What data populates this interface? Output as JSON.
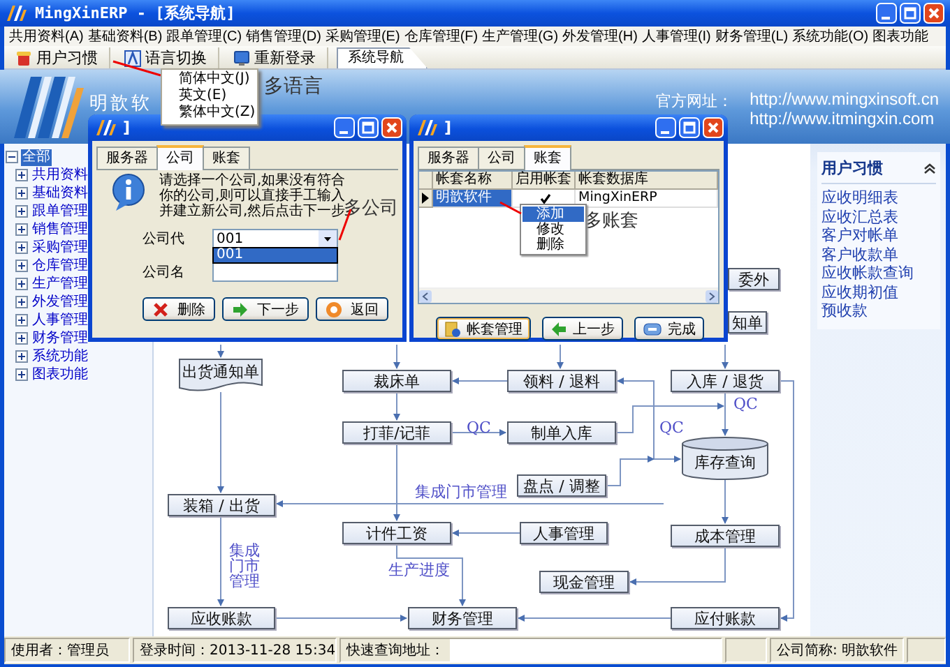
{
  "window": {
    "title": "MingXinERP - [系统导航]"
  },
  "menu_bar": [
    "共用资料(A)",
    "基础资料(B)",
    "跟单管理(C)",
    "销售管理(D)",
    "采购管理(E)",
    "仓库管理(F)",
    "生产管理(G)",
    "外发管理(H)",
    "人事管理(I)",
    "财务管理(L)",
    "系统功能(O)",
    "图表功能"
  ],
  "toolbar": [
    {
      "label": "用户习惯",
      "kind": "habits"
    },
    {
      "label": "语言切换",
      "kind": "language"
    },
    {
      "label": "重新登录",
      "kind": "relogin"
    }
  ],
  "document_tabs": [
    {
      "label": "系统导航",
      "selected": true
    }
  ],
  "language_menu": {
    "items": [
      "简体中文(J)",
      "英文(E)",
      "繁体中文(Z)"
    ],
    "annotation": "多语言"
  },
  "banner": {
    "brand": "明歆软",
    "site_label": "官方网址：",
    "urls": [
      "http://www.mingxinsoft.cn",
      "http://www.itmingxin.com"
    ]
  },
  "tree": [
    {
      "label": "全部",
      "selected": true,
      "expanded": true,
      "children": [
        {
          "label": "共用资料",
          "selected": false,
          "expanded": false
        },
        {
          "label": "基础资料",
          "selected": false,
          "expanded": false
        },
        {
          "label": "跟单管理",
          "selected": false,
          "expanded": false
        },
        {
          "label": "销售管理",
          "selected": false,
          "expanded": false
        },
        {
          "label": "采购管理",
          "selected": false,
          "expanded": false
        },
        {
          "label": "仓库管理",
          "selected": false,
          "expanded": false
        },
        {
          "label": "生产管理",
          "selected": false,
          "expanded": false
        },
        {
          "label": "外发管理",
          "selected": false,
          "expanded": false
        },
        {
          "label": "人事管理",
          "selected": false,
          "expanded": false
        },
        {
          "label": "财务管理",
          "selected": false,
          "expanded": false
        },
        {
          "label": "系统功能",
          "selected": false,
          "expanded": false
        },
        {
          "label": "图表功能",
          "selected": false,
          "expanded": false
        }
      ]
    }
  ],
  "flowchart": {
    "nodes": [
      {
        "kind": "box",
        "label": "委外"
      },
      {
        "kind": "box",
        "label": "知单"
      },
      {
        "kind": "document",
        "label": "出货通知单"
      },
      {
        "kind": "box",
        "label": "裁床单"
      },
      {
        "kind": "box",
        "label": "领料 / 退料"
      },
      {
        "kind": "box",
        "label": "入库 / 退货"
      },
      {
        "kind": "box",
        "label": "打菲/记菲"
      },
      {
        "kind": "box",
        "label": "制单入库"
      },
      {
        "kind": "cylinder",
        "label": "库存查询"
      },
      {
        "kind": "box",
        "label": "盘点 / 调整"
      },
      {
        "kind": "box",
        "label": "装箱 / 出货"
      },
      {
        "kind": "box",
        "label": "计件工资"
      },
      {
        "kind": "box",
        "label": "人事管理"
      },
      {
        "kind": "box",
        "label": "成本管理"
      },
      {
        "kind": "box",
        "label": "现金管理"
      },
      {
        "kind": "box",
        "label": "应收账款"
      },
      {
        "kind": "box",
        "label": "财务管理"
      },
      {
        "kind": "box",
        "label": "应付账款"
      }
    ],
    "labels": [
      {
        "kind": "horizontal",
        "text": "QC"
      },
      {
        "kind": "horizontal",
        "text": "QC"
      },
      {
        "kind": "horizontal",
        "text": "QC"
      },
      {
        "kind": "horizontal",
        "text": "集成门市管理"
      },
      {
        "kind": "vertical",
        "text": "集成门市管理"
      },
      {
        "kind": "horizontal",
        "text": "生产进度"
      }
    ]
  },
  "user_panel": {
    "title": "用户习惯",
    "links": [
      "应收明细表",
      "应收汇总表",
      "客户对帐单",
      "客户收款单",
      "应收帐款查询",
      "应收期初值",
      "预收款"
    ]
  },
  "company_dialog": {
    "title": "]",
    "tabs": [
      {
        "label": "服务器",
        "selected": false
      },
      {
        "label": "公司",
        "selected": true
      },
      {
        "label": "账套",
        "selected": false
      }
    ],
    "message": [
      "请选择一个公司,如果没有符合",
      "你的公司,则可以直接手工输入",
      "并建立新公司,然后点击下一步"
    ],
    "annotation": "多公司",
    "fields": [
      {
        "label": "公司代",
        "value": "001"
      },
      {
        "label": "公司名"
      }
    ],
    "dropdown_options": [
      {
        "label": "001",
        "selected": true
      }
    ],
    "buttons": [
      {
        "label": "删除",
        "kind": "delete"
      },
      {
        "label": "下一步",
        "kind": "next"
      },
      {
        "label": "返回",
        "kind": "return"
      }
    ]
  },
  "account_dialog": {
    "title": "]",
    "tabs": [
      {
        "label": "服务器",
        "selected": false
      },
      {
        "label": "公司",
        "selected": false
      },
      {
        "label": "账套",
        "selected": true
      }
    ],
    "columns": [
      "帐套名称",
      "启用帐套",
      "帐套数据库"
    ],
    "rows": [
      {
        "name": "明歆软件",
        "checked": true,
        "database": "MingXinERP",
        "selected": true
      }
    ],
    "context_menu": [
      {
        "label": "添加",
        "selected": true
      },
      {
        "label": "修改",
        "selected": false
      },
      {
        "label": "删除",
        "selected": false
      }
    ],
    "annotation": "多账套",
    "buttons": [
      {
        "label": "帐套管理",
        "kind": "manage"
      },
      {
        "label": "上一步",
        "kind": "previous"
      },
      {
        "label": "完成",
        "kind": "finish"
      }
    ]
  },
  "status_bar": {
    "user": "使用者：管理员",
    "login_time": "登录时间：2013-11-28 15:34",
    "quick_query_label": "快速查询地址：",
    "company": "公司简称: 明歆软件"
  }
}
